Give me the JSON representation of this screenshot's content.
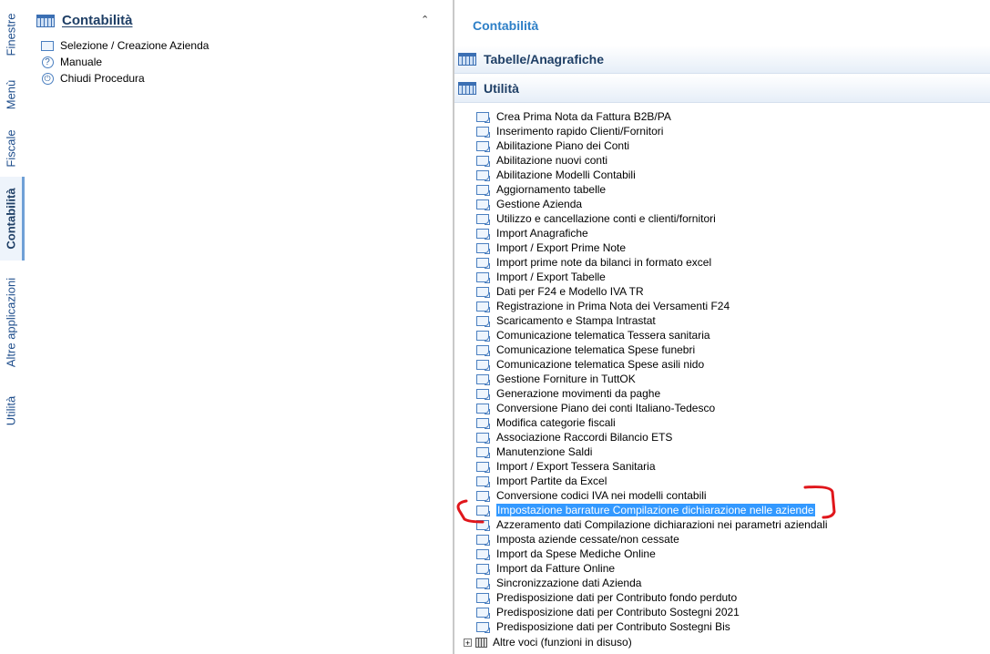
{
  "vertical_tabs": [
    {
      "label": "Finestre",
      "active": false
    },
    {
      "label": "Menù",
      "active": false
    },
    {
      "label": "Fiscale",
      "active": false
    },
    {
      "label": "Contabilità",
      "active": true
    },
    {
      "label": "Altre applicazioni",
      "active": false
    },
    {
      "label": "Utilità",
      "active": false
    }
  ],
  "left_panel": {
    "title": "Contabilità",
    "items": [
      {
        "label": "Selezione / Creazione Azienda",
        "icon": "doc-icon"
      },
      {
        "label": "Manuale",
        "icon": "help-icon"
      },
      {
        "label": "Chiudi Procedura",
        "icon": "power-icon"
      }
    ]
  },
  "right_panel": {
    "title": "Contabilità",
    "sections": [
      {
        "label": "Tabelle/Anagrafiche"
      },
      {
        "label": "Utilità"
      }
    ],
    "items": [
      "Crea Prima Nota da Fattura B2B/PA",
      "Inserimento rapido Clienti/Fornitori",
      "Abilitazione Piano dei Conti",
      "Abilitazione nuovi conti",
      "Abilitazione Modelli Contabili",
      "Aggiornamento tabelle",
      "Gestione Azienda",
      "Utilizzo e cancellazione conti e clienti/fornitori",
      "Import Anagrafiche",
      "Import / Export Prime Note",
      "Import prime note da bilanci in formato excel",
      "Import / Export Tabelle",
      "Dati per F24 e Modello IVA TR",
      "Registrazione in Prima Nota dei Versamenti F24",
      "Scaricamento e Stampa Intrastat",
      "Comunicazione telematica Tessera sanitaria",
      "Comunicazione telematica Spese funebri",
      "Comunicazione telematica Spese asili nido",
      "Gestione Forniture in TuttOK",
      "Generazione movimenti da paghe",
      "Conversione Piano dei conti Italiano-Tedesco",
      "Modifica categorie fiscali",
      "Associazione Raccordi Bilancio ETS",
      "Manutenzione Saldi",
      "Import / Export Tessera Sanitaria",
      "Import Partite da Excel",
      "Conversione codici IVA nei modelli contabili",
      "Impostazione barrature Compilazione dichiarazione nelle aziende",
      "Azzeramento dati Compilazione dichiarazioni nei parametri aziendali",
      "Imposta aziende cessate/non cessate",
      "Import da Spese Mediche Online",
      "Import da Fatture Online",
      "Sincronizzazione dati Azienda",
      "Predisposizione dati per Contributo fondo perduto",
      "Predisposizione dati per Contributo Sostegni 2021",
      "Predisposizione dati per Contributo Sostegni Bis"
    ],
    "selected_index": 27,
    "footer_item": "Altre voci (funzioni in disuso)",
    "selection_color": "#3399ff",
    "annotation_color": "#e0161b"
  }
}
